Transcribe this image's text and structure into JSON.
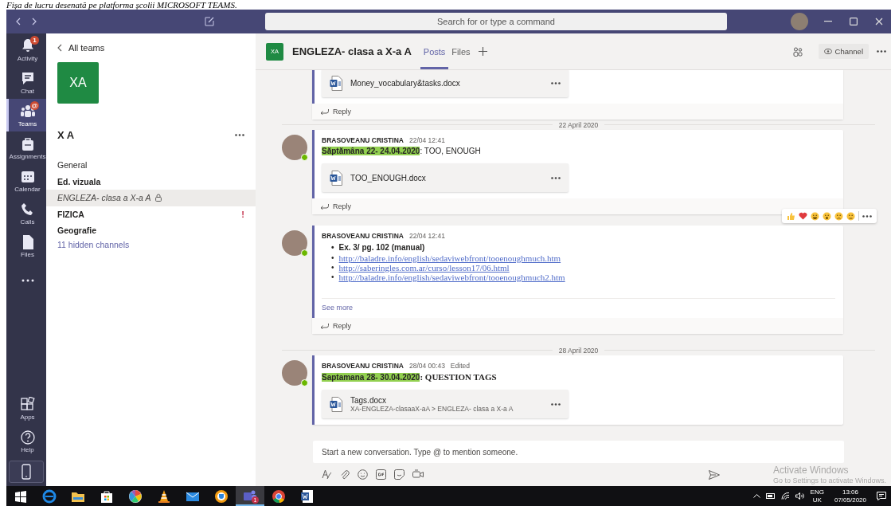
{
  "caption": "Fișa de lucru desenată pe platforma școlii MICROSOFT TEAMS.",
  "titlebar": {
    "search_placeholder": "Search for or type a command"
  },
  "rail": [
    {
      "kind": "bell",
      "label": "Activity",
      "selected": false,
      "badge": "1"
    },
    {
      "kind": "chat",
      "label": "Chat",
      "selected": false
    },
    {
      "kind": "teams",
      "label": "Teams",
      "selected": true,
      "badge": "@"
    },
    {
      "kind": "bag",
      "label": "Assignments",
      "selected": false
    },
    {
      "kind": "calendar",
      "label": "Calendar",
      "selected": false
    },
    {
      "kind": "phone",
      "label": "Calls",
      "selected": false
    },
    {
      "kind": "file",
      "label": "Files",
      "selected": false
    },
    {
      "kind": "more",
      "selected": false
    }
  ],
  "rail_bottom": [
    {
      "kind": "apps",
      "label": "Apps"
    },
    {
      "kind": "help",
      "label": "Help"
    },
    {
      "kind": "device"
    }
  ],
  "team_panel": {
    "back": "All teams",
    "avatar": "XA",
    "name": "X A",
    "channels": [
      {
        "name": "General",
        "unread": false,
        "selected": false,
        "private": false
      },
      {
        "name": "Ed. vizuala",
        "unread": true,
        "selected": false,
        "private": false
      },
      {
        "name": "ENGLEZA- clasa a X-a A",
        "unread": false,
        "selected": true,
        "private": true
      },
      {
        "name": "FIZICA",
        "unread": true,
        "selected": false,
        "private": false,
        "alert": "!"
      },
      {
        "name": "Geografie",
        "unread": true,
        "selected": false,
        "private": false
      }
    ],
    "hidden": "11 hidden channels"
  },
  "header": {
    "avatar": "XA",
    "title": "ENGLEZA- clasa a X-a A",
    "tabs": [
      {
        "label": "Posts",
        "selected": true
      },
      {
        "label": "Files",
        "selected": false
      }
    ],
    "channel_button": "Channel"
  },
  "feed": [
    {
      "kind": "tail",
      "attachments": [
        {
          "name": "Money_vocabulary&tasks.docx"
        }
      ],
      "reply": "Reply"
    },
    {
      "kind": "date",
      "text": "22 April 2020"
    },
    {
      "kind": "post",
      "author": "BRASOVEANU CRISTINA",
      "time": "22/04 12:41",
      "headline": {
        "highlight": "Săptămâna 22- 24.04.2020",
        "rest": ": TOO, ENOUGH",
        "kind": "plain"
      },
      "attachments": [
        {
          "name": "TOO_ENOUGH.docx"
        }
      ],
      "reply": "Reply",
      "reactions": true
    },
    {
      "kind": "post",
      "author": "BRASOVEANU CRISTINA",
      "time": "22/04 12:41",
      "list": [
        {
          "kind": "bold",
          "bullet": "•",
          "text": "Ex. 3/ pg. 102 (manual)"
        },
        {
          "kind": "link",
          "bullet": "•",
          "text": "http://baladre.info/english/sedaviwebfront/tooenoughmuch.htm"
        },
        {
          "kind": "link",
          "bullet": "•",
          "text": "http://saberingles.com.ar/curso/lesson17/06.html"
        },
        {
          "kind": "link",
          "bullet": "•",
          "text": "http://baladre.info/english/sedaviwebfront/tooenoughmuch2.htm"
        }
      ],
      "see_more": "See more",
      "reply": "Reply",
      "reactions": false
    },
    {
      "kind": "date",
      "text": "28 April 2020"
    },
    {
      "kind": "post",
      "author": "BRASOVEANU CRISTINA",
      "time": "28/04 00:43",
      "edited": "Edited",
      "headline": {
        "highlight": "Saptamana 28- 30.04.2020",
        "rest": ": QUESTION TAGS",
        "kind": "serif"
      },
      "attachments": [
        {
          "name": "Tags.docx",
          "path": "XA-ENGLEZA-clasaaX-aA > ENGLEZA- clasa a X-a A"
        }
      ],
      "reactions": false
    }
  ],
  "compose": {
    "placeholder": "Start a new conversation. Type @ to mention someone."
  },
  "activation_notice": {
    "title": "Activate Windows",
    "text": "Go to Settings to activate Windows."
  },
  "taskbar": {
    "apps": [
      {
        "kind": "start",
        "selected": false
      },
      {
        "kind": "globe",
        "selected": false
      },
      {
        "kind": "folder",
        "selected": false
      },
      {
        "kind": "bag",
        "selected": false
      },
      {
        "kind": "pinwheel",
        "selected": false
      },
      {
        "kind": "cone",
        "selected": false
      },
      {
        "kind": "mail",
        "selected": false
      },
      {
        "kind": "shield",
        "selected": false
      },
      {
        "kind": "people",
        "selected": true,
        "badge": "1"
      },
      {
        "kind": "ring",
        "selected": false
      },
      {
        "kind": "document",
        "selected": false
      }
    ],
    "tray": {
      "lang": "ENG",
      "region": "UK",
      "time": "13:06",
      "date": "07/05/2020"
    }
  }
}
